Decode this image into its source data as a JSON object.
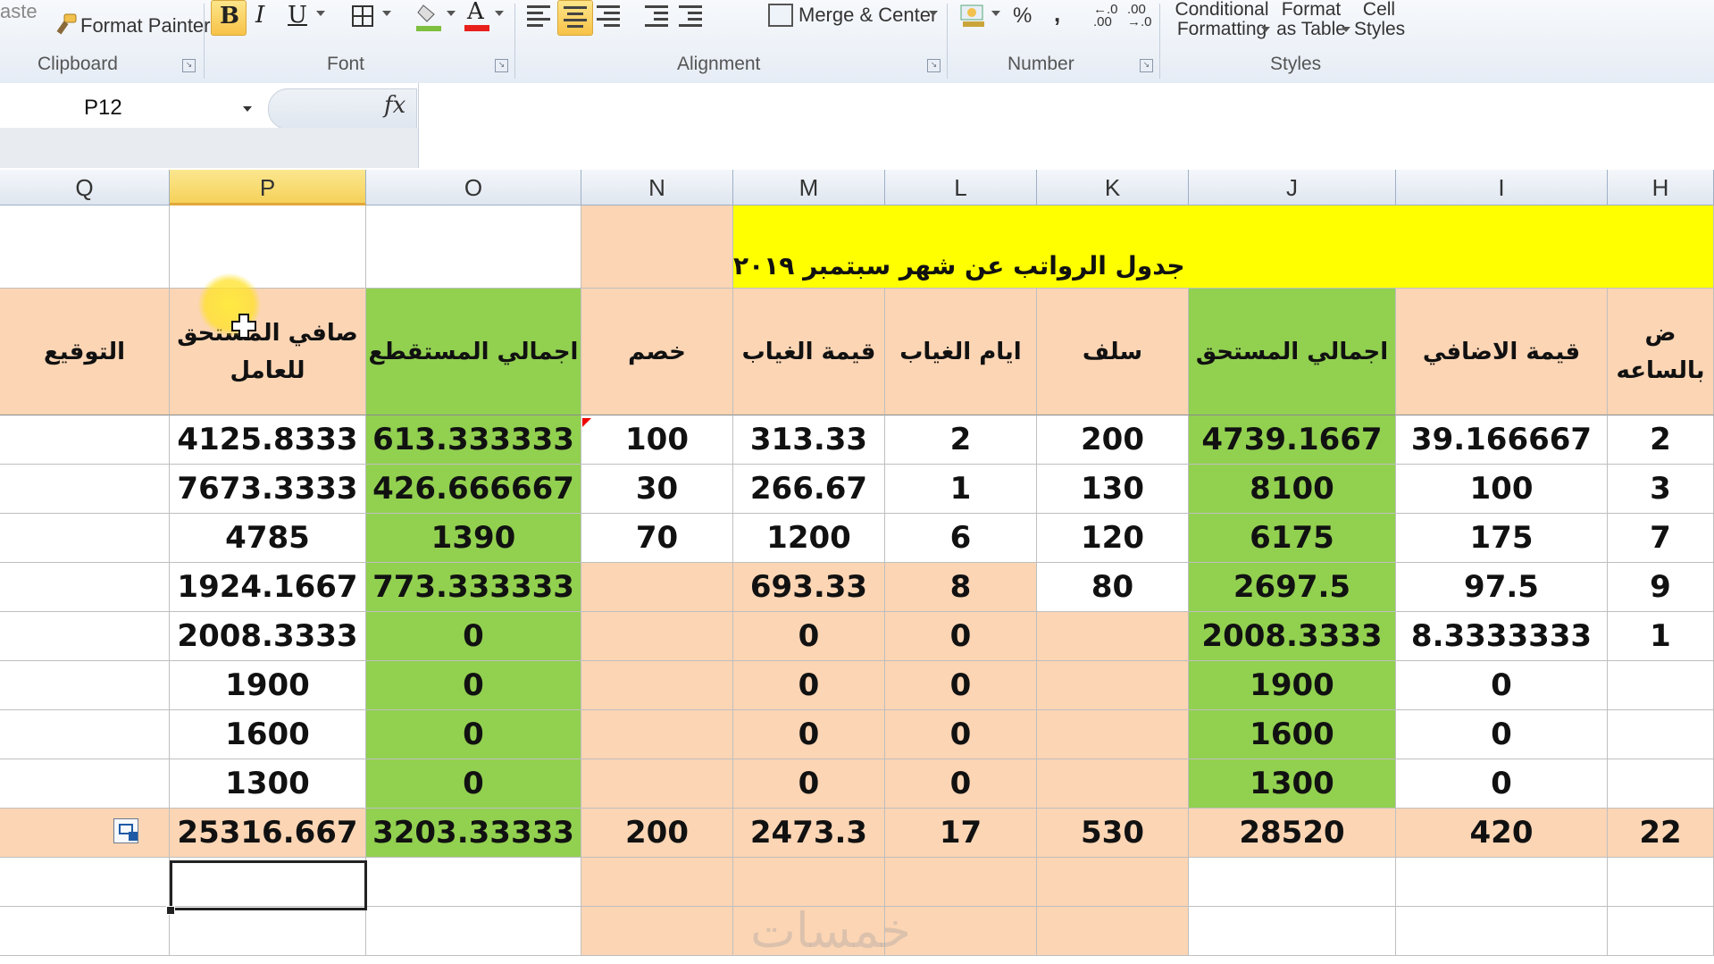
{
  "ribbon": {
    "paste_label": "aste",
    "format_painter_label": "Format Painter",
    "groups": {
      "clipboard": "Clipboard",
      "font": "Font",
      "alignment": "Alignment",
      "number": "Number",
      "styles": "Styles"
    },
    "bold_glyph": "B",
    "italic_glyph": "I",
    "underline_glyph": "U",
    "font_color_glyph": "A",
    "merge_center_label": "Merge & Center",
    "percent_glyph": "%",
    "comma_glyph": ",",
    "inc_decimal": "←.0 .00",
    "dec_decimal": ".00 →.0",
    "conditional_formatting": [
      "Conditional",
      "Formatting"
    ],
    "format_as_table": [
      "Format",
      "as Table"
    ],
    "cell_styles": [
      "Cell",
      "Styles"
    ]
  },
  "formula_bar": {
    "name_box": "P12",
    "fx_label": "fx",
    "formula": ""
  },
  "sheet": {
    "active_column": "P",
    "column_headers": [
      "Q",
      "P",
      "O",
      "N",
      "M",
      "L",
      "K",
      "J",
      "I",
      "H"
    ],
    "title": "جدول الرواتب عن شهر سبتمبر ٢٠١٩",
    "headers": {
      "Q": "التوقيع",
      "P": "صافي المستحق للعامل",
      "O": "اجمالي المستقطع",
      "N": "خصم",
      "M": "قيمة الغياب",
      "L": "ايام الغياب",
      "K": "سلف",
      "J": "اجمالي المستحق",
      "I": "قيمة الاضافي",
      "H": "ض بالساعه"
    },
    "rows": [
      {
        "P": "4125.8333",
        "O": "613.333333",
        "N": "100",
        "M": "313.33",
        "L": "2",
        "K": "200",
        "J": "4739.1667",
        "I": "39.166667",
        "H": "2"
      },
      {
        "P": "7673.3333",
        "O": "426.666667",
        "N": "30",
        "M": "266.67",
        "L": "1",
        "K": "130",
        "J": "8100",
        "I": "100",
        "H": "3"
      },
      {
        "P": "4785",
        "O": "1390",
        "N": "70",
        "M": "1200",
        "L": "6",
        "K": "120",
        "J": "6175",
        "I": "175",
        "H": "7"
      },
      {
        "P": "1924.1667",
        "O": "773.333333",
        "N": "",
        "M": "693.33",
        "L": "8",
        "K": "80",
        "J": "2697.5",
        "I": "97.5",
        "H": "9"
      },
      {
        "P": "2008.3333",
        "O": "0",
        "N": "",
        "M": "0",
        "L": "0",
        "K": "",
        "J": "2008.3333",
        "I": "8.3333333",
        "H": "1"
      },
      {
        "P": "1900",
        "O": "0",
        "N": "",
        "M": "0",
        "L": "0",
        "K": "",
        "J": "1900",
        "I": "0",
        "H": ""
      },
      {
        "P": "1600",
        "O": "0",
        "N": "",
        "M": "0",
        "L": "0",
        "K": "",
        "J": "1600",
        "I": "0",
        "H": ""
      },
      {
        "P": "1300",
        "O": "0",
        "N": "",
        "M": "0",
        "L": "0",
        "K": "",
        "J": "1300",
        "I": "0",
        "H": ""
      }
    ],
    "totals": {
      "P": "25316.667",
      "O": "3203.33333",
      "N": "200",
      "M": "2473.3",
      "L": "17",
      "K": "530",
      "J": "28520",
      "I": "420",
      "H": "22"
    },
    "watermark": "خمسات",
    "colors": {
      "peach": "#fcd5b4",
      "green": "#92d050",
      "title_yellow": "#ffff00",
      "active_header": "#f6d15a"
    }
  }
}
